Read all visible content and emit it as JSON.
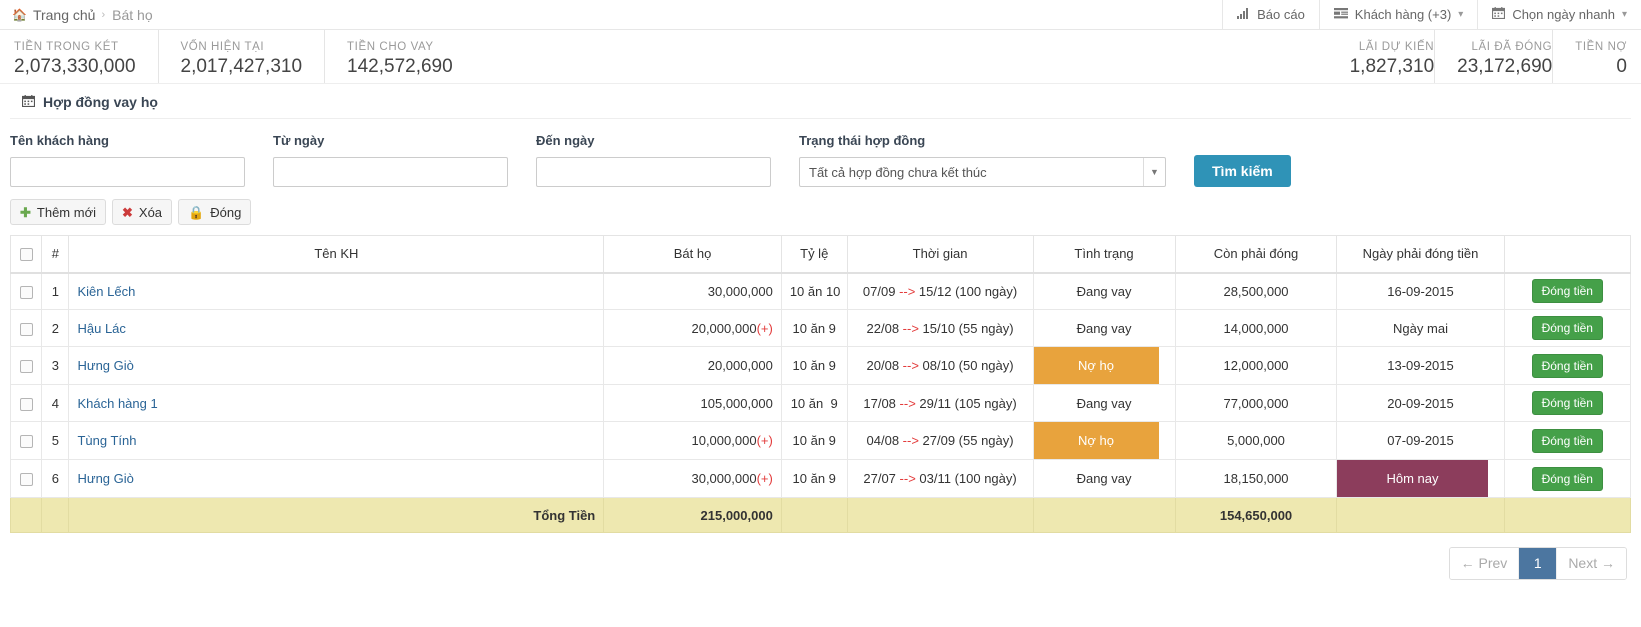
{
  "topbar": {
    "breadcrumb": {
      "home_icon": "home-icon",
      "root": "Trang chủ",
      "separator": "›",
      "current": "Bát họ"
    },
    "nav": [
      {
        "icon": "bar-chart-icon",
        "label": "Báo cáo",
        "caret": ""
      },
      {
        "icon": "list-icon",
        "label": "Khách hàng (+3)",
        "caret": "⌄"
      },
      {
        "icon": "calendar-icon",
        "label": "Chọn ngày nhanh",
        "caret": "⌄"
      }
    ]
  },
  "stats": {
    "left": [
      {
        "label": "TIỀN TRONG KÉT",
        "value": "2,073,330,000"
      },
      {
        "label": "VỐN HIỆN TẠI",
        "value": "2,017,427,310"
      },
      {
        "label": "TIỀN CHO VAY",
        "value": "142,572,690"
      }
    ],
    "right": [
      {
        "label": "LÃI DỰ KIẾN",
        "value": "1,827,310"
      },
      {
        "label": "LÃI ĐÃ ĐÓNG",
        "value": "23,172,690"
      },
      {
        "label": "TIỀN NỢ",
        "value": "0"
      }
    ]
  },
  "panel": {
    "icon": "calendar-icon",
    "title": "Hợp đồng vay họ"
  },
  "filters": {
    "customer_name": {
      "label": "Tên khách hàng",
      "value": "",
      "placeholder": ""
    },
    "from_date": {
      "label": "Từ ngày",
      "value": "",
      "placeholder": ""
    },
    "to_date": {
      "label": "Đến ngày",
      "value": "",
      "placeholder": ""
    },
    "status": {
      "label": "Trạng thái hợp đồng",
      "selected": "Tất cả hợp đồng chưa kết thúc",
      "options": [
        "Tất cả hợp đồng chưa kết thúc"
      ]
    },
    "search_button": "Tìm kiếm"
  },
  "actions": [
    {
      "icon": "plus-icon",
      "label": "Thêm mới"
    },
    {
      "icon": "delete-x-icon",
      "label": "Xóa"
    },
    {
      "icon": "lock-icon",
      "label": "Đóng"
    }
  ],
  "table": {
    "columns": [
      "",
      "#",
      "Tên KH",
      "Bát họ",
      "Tỷ lệ",
      "Thời gian",
      "Tình trạng",
      "Còn phải đóng",
      "Ngày phải đóng tiền",
      ""
    ],
    "pay_button_label": "Đóng tiền",
    "rows": [
      {
        "index": "1",
        "name": "Kiên Lếch",
        "amount": "30,000,000",
        "plus": "",
        "rate": "10 ăn 10",
        "time": "07/09 --> 15/12 (100 ngày)",
        "time_start": "07/09",
        "time_arrow": "-->",
        "time_end": "15/12 (100 ngày)",
        "status": "Đang vay",
        "status_style": "plain",
        "remaining": "28,500,000",
        "due_date": "16-09-2015",
        "due_style": "plain"
      },
      {
        "index": "2",
        "name": "Hậu Lác",
        "amount": "20,000,000",
        "plus": "(+)",
        "rate": "10 ăn 9",
        "time": "22/08 --> 15/10 (55 ngày)",
        "time_start": "22/08",
        "time_arrow": "-->",
        "time_end": "15/10 (55 ngày)",
        "status": "Đang vay",
        "status_style": "plain",
        "remaining": "14,000,000",
        "due_date": "Ngày mai",
        "due_style": "plain"
      },
      {
        "index": "3",
        "name": "Hưng Giò",
        "amount": "20,000,000",
        "plus": "",
        "rate": "10 ăn 9",
        "time": "20/08 --> 08/10 (50 ngày)",
        "time_start": "20/08",
        "time_arrow": "-->",
        "time_end": "08/10 (50 ngày)",
        "status": "Nợ họ",
        "status_style": "owe",
        "remaining": "12,000,000",
        "due_date": "13-09-2015",
        "due_style": "plain"
      },
      {
        "index": "4",
        "name": "Khách hàng 1",
        "amount": "105,000,000",
        "plus": "",
        "rate": "10 ăn  9",
        "time": "17/08 --> 29/11 (105 ngày)",
        "time_start": "17/08",
        "time_arrow": "-->",
        "time_end": "29/11 (105 ngày)",
        "status": "Đang vay",
        "status_style": "plain",
        "remaining": "77,000,000",
        "due_date": "20-09-2015",
        "due_style": "plain"
      },
      {
        "index": "5",
        "name": "Tùng Tính",
        "amount": "10,000,000",
        "plus": "(+)",
        "rate": "10 ăn 9",
        "time": "04/08 --> 27/09 (55 ngày)",
        "time_start": "04/08",
        "time_arrow": "-->",
        "time_end": "27/09 (55 ngày)",
        "status": "Nợ họ",
        "status_style": "owe",
        "remaining": "5,000,000",
        "due_date": "07-09-2015",
        "due_style": "plain"
      },
      {
        "index": "6",
        "name": "Hưng Giò",
        "amount": "30,000,000",
        "plus": "(+)",
        "rate": "10 ăn 9",
        "time": "27/07 --> 03/11 (100 ngày)",
        "time_start": "27/07",
        "time_arrow": "-->",
        "time_end": "03/11 (100 ngày)",
        "status": "Đang vay",
        "status_style": "plain",
        "remaining": "18,150,000",
        "due_date": "Hôm nay",
        "due_style": "today"
      }
    ],
    "total": {
      "label": "Tổng Tiền",
      "amount": "215,000,000",
      "remaining": "154,650,000"
    }
  },
  "pagination": {
    "prev": "← Prev",
    "pages": [
      "1"
    ],
    "next": "Next →",
    "active": "1"
  }
}
